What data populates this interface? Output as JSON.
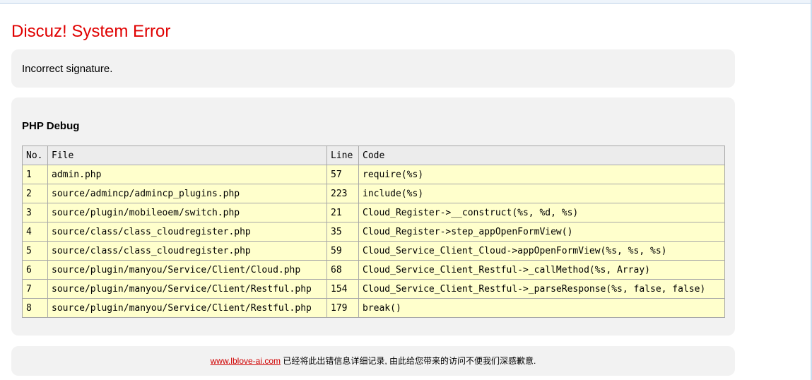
{
  "page": {
    "title": "Discuz! System Error",
    "message": "Incorrect signature."
  },
  "debug": {
    "title": "PHP Debug",
    "columns": [
      "No.",
      "File",
      "Line",
      "Code"
    ],
    "rows": [
      {
        "no": "1",
        "file": "admin.php",
        "line": "57",
        "code": "require(%s)"
      },
      {
        "no": "2",
        "file": "source/admincp/admincp_plugins.php",
        "line": "223",
        "code": "include(%s)"
      },
      {
        "no": "3",
        "file": "source/plugin/mobileoem/switch.php",
        "line": "21",
        "code": "Cloud_Register->__construct(%s, %d, %s)"
      },
      {
        "no": "4",
        "file": "source/class/class_cloudregister.php",
        "line": "35",
        "code": "Cloud_Register->step_appOpenFormView()"
      },
      {
        "no": "5",
        "file": "source/class/class_cloudregister.php",
        "line": "59",
        "code": "Cloud_Service_Client_Cloud->appOpenFormView(%s, %s, %s)"
      },
      {
        "no": "6",
        "file": "source/plugin/manyou/Service/Client/Cloud.php",
        "line": "68",
        "code": "Cloud_Service_Client_Restful->_callMethod(%s, Array)"
      },
      {
        "no": "7",
        "file": "source/plugin/manyou/Service/Client/Restful.php",
        "line": "154",
        "code": "Cloud_Service_Client_Restful->_parseResponse(%s, false, false)"
      },
      {
        "no": "8",
        "file": "source/plugin/manyou/Service/Client/Restful.php",
        "line": "179",
        "code": "break()"
      }
    ]
  },
  "footer": {
    "link_text": "www.lblove-ai.com",
    "text": " 已经将此出错信息详细记录, 由此给您带来的访问不便我们深感歉意."
  },
  "colors": {
    "title": "#e00000",
    "panel_bg": "#f2f2f2",
    "row_bg": "#ffffcc",
    "header_bg": "#ececec",
    "link": "#d00000"
  }
}
